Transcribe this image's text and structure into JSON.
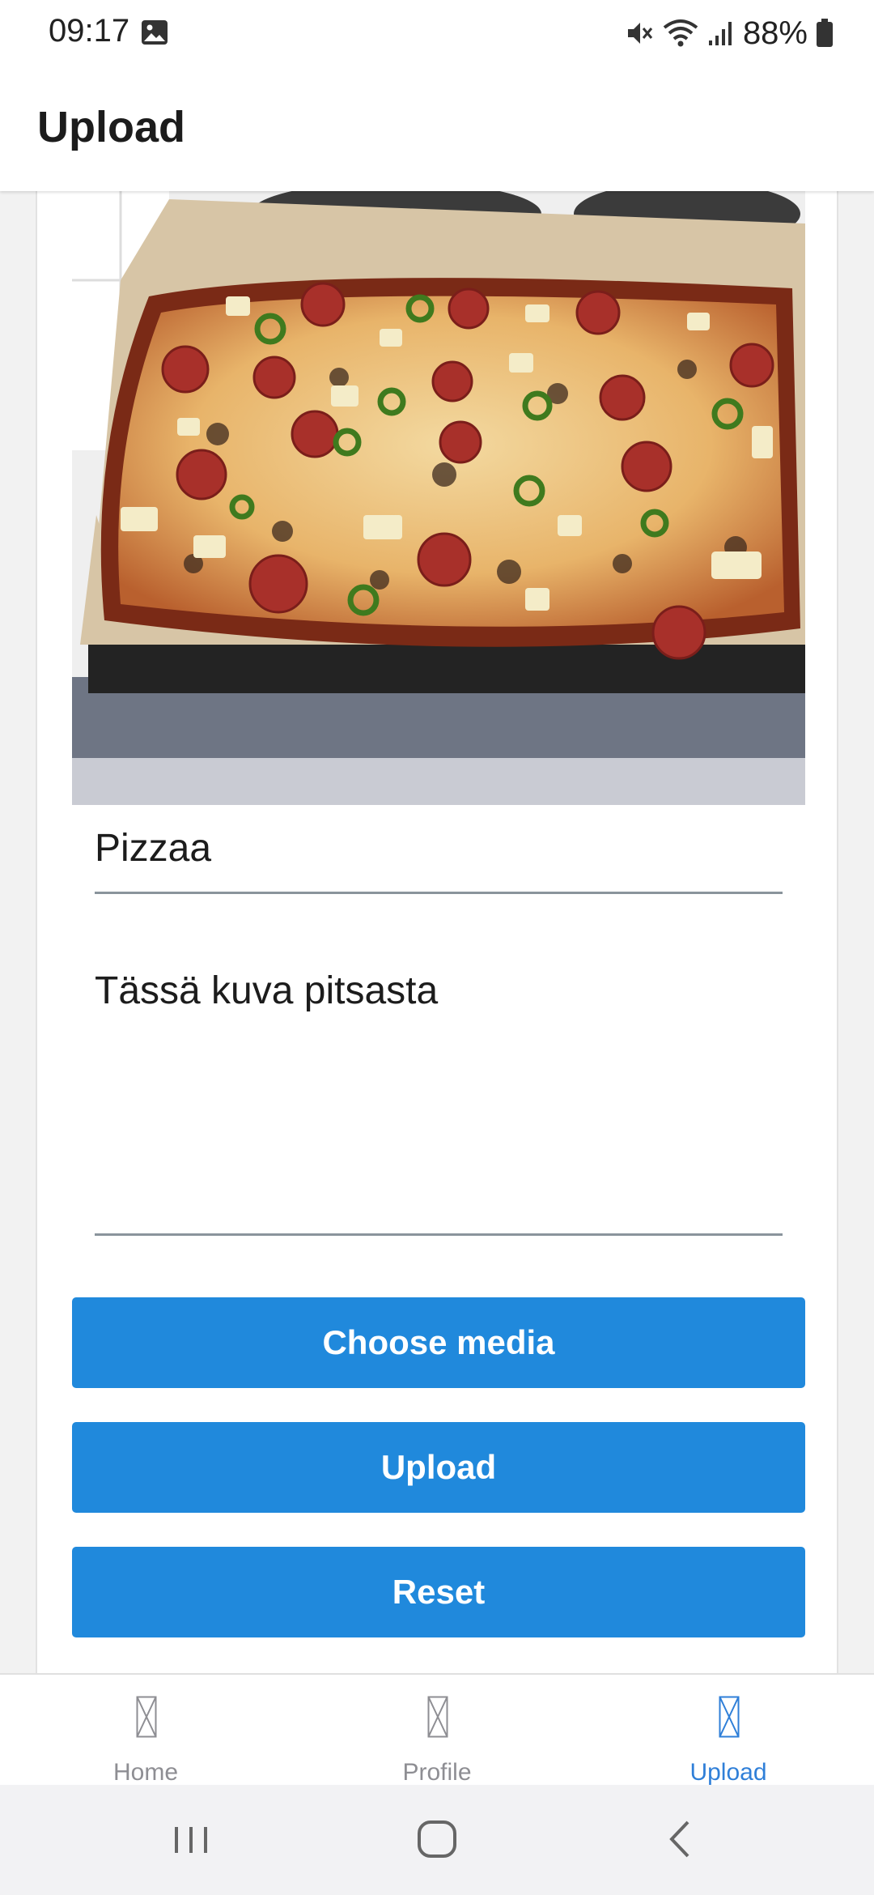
{
  "status_bar": {
    "time": "09:17",
    "battery_percent": "88%",
    "icons": [
      "gallery-icon",
      "mute-icon",
      "wifi-icon",
      "signal-icon",
      "battery-icon"
    ]
  },
  "header": {
    "title": "Upload"
  },
  "form": {
    "title_value": "Pizzaa",
    "description_value": "Tässä kuva pitsasta",
    "choose_label": "Choose media",
    "upload_label": "Upload",
    "reset_label": "Reset"
  },
  "tabs": [
    {
      "label": "Home",
      "icon": "placeholder-icon",
      "active": false
    },
    {
      "label": "Profile",
      "icon": "placeholder-icon",
      "active": false
    },
    {
      "label": "Upload",
      "icon": "placeholder-icon",
      "active": true
    }
  ],
  "colors": {
    "accent": "#2089dc",
    "active_tab": "#2f7fd8",
    "inactive_tab": "#8e8e93"
  }
}
